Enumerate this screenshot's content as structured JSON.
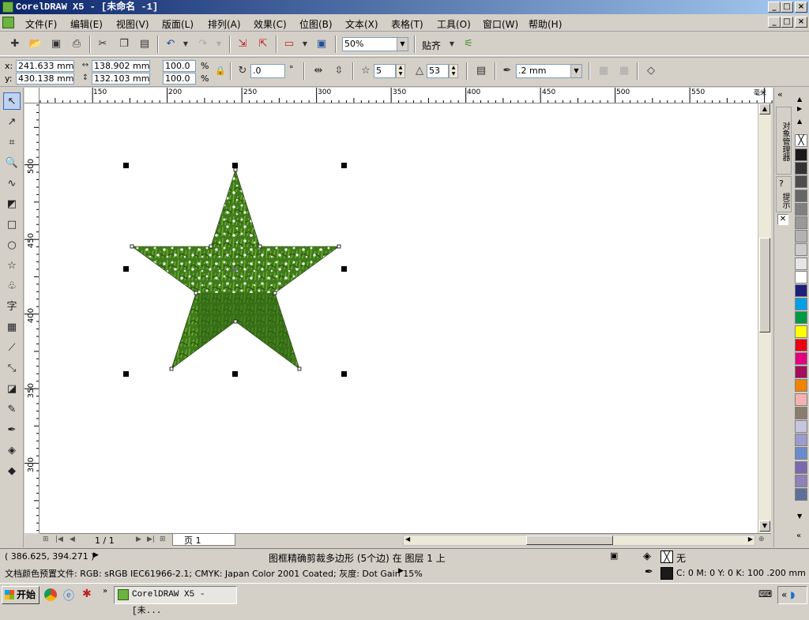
{
  "window": {
    "title": "CorelDRAW X5 - [未命名 -1]",
    "controls": [
      "_",
      "□",
      "×"
    ]
  },
  "menubar": {
    "items": [
      "文件(F)",
      "编辑(E)",
      "视图(V)",
      "版面(L)",
      "排列(A)",
      "效果(C)",
      "位图(B)",
      "文本(X)",
      "表格(T)",
      "工具(O)",
      "窗口(W)",
      "帮助(H)"
    ]
  },
  "stdbar": {
    "zoom": "50%",
    "snap_label": "贴齐"
  },
  "propbar": {
    "x_label": "x:",
    "y_label": "y:",
    "x_value": "241.633 mm",
    "y_value": "430.138 mm",
    "width_value": "138.902 mm",
    "height_value": "132.103 mm",
    "scale_w": "100.0",
    "scale_h": "100.0",
    "percent": "%",
    "rotation": ".0",
    "degree": "°",
    "points": "5",
    "sharpness": "53",
    "outline_width": ".2 mm"
  },
  "ruler": {
    "top_labels": [
      "150",
      "200",
      "250",
      "300",
      "350",
      "400",
      "450",
      "500",
      "550"
    ],
    "left_labels": [
      "500",
      "450",
      "400",
      "350",
      "300"
    ],
    "unit": "毫米"
  },
  "page_nav": {
    "page_count": "1 / 1",
    "tab": "页 1"
  },
  "dockers": {
    "obj_manager": "对象管理器",
    "hints": "提示"
  },
  "palette": {
    "colors": [
      "#ffffff",
      "#1a1a1a",
      "#333333",
      "#4d4d4d",
      "#666666",
      "#808080",
      "#999999",
      "#b3b3b3",
      "#cccccc",
      "#e6e6e6",
      "#ffffff",
      "#1f1f7a",
      "#00a0e9",
      "#009944",
      "#ffff00",
      "#e60012",
      "#e4007f",
      "#a40c5c",
      "#f08300",
      "#f5b2b2",
      "#8b7d6b",
      "#c8c6df",
      "#9c9ccc",
      "#6b8ccc",
      "#7a6aad",
      "#8e82b8",
      "#5f6f99"
    ]
  },
  "status": {
    "coords": "( 386.625, 394.271 )",
    "selection": "图框精确剪裁多边形 (5个边) 在 图层 1 上",
    "profile": "文档颜色预置文件: RGB: sRGB IEC61966-2.1; CMYK: Japan Color 2001 Coated; 灰度: Dot Gain 15%",
    "fill_label": "无",
    "outline_info": "C: 0 M: 0 Y: 0 K: 100  .200 mm"
  },
  "taskbar": {
    "start": "开始",
    "task": "CorelDRAW X5 - [未..."
  }
}
